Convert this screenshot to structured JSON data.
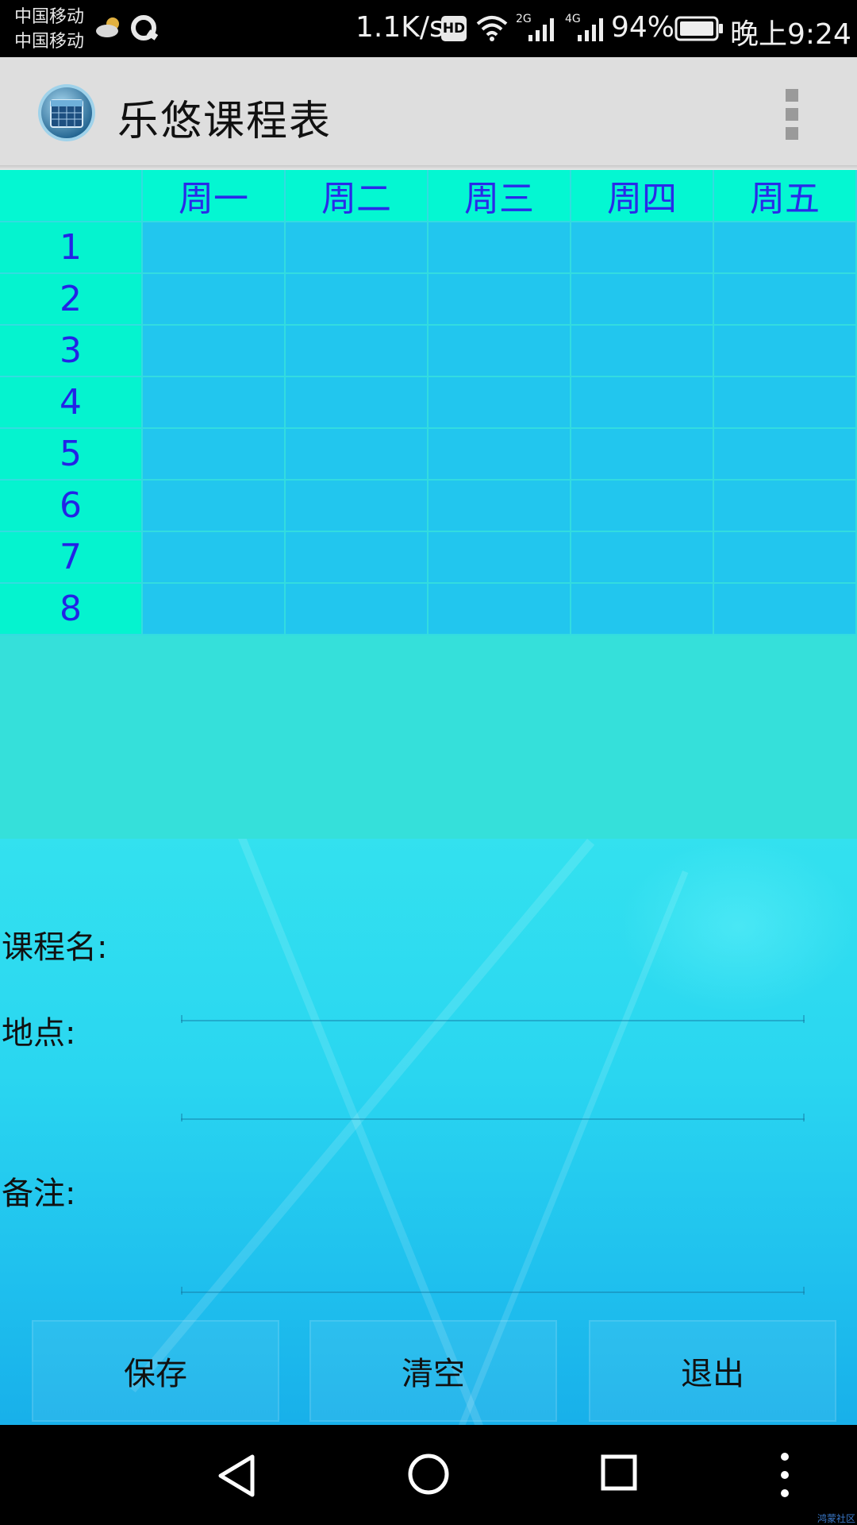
{
  "status_bar": {
    "carrier_1": "中国移动",
    "carrier_2": "中国移动",
    "net_speed": "1.1K/s",
    "hd_badge": "HD",
    "sig_2g": "2G",
    "sig_4g": "4G",
    "battery": "94%",
    "time": "晚上9:24",
    "icons": [
      "weather-cloudy-icon",
      "q-app-icon",
      "wifi-icon",
      "signal-icon",
      "battery-icon"
    ]
  },
  "app_bar": {
    "title": "乐悠课程表",
    "logo_icon": "calendar-icon",
    "menu_icon": "overflow-menu-icon"
  },
  "timetable": {
    "days": [
      "周一",
      "周二",
      "周三",
      "周四",
      "周五"
    ],
    "periods": [
      "1",
      "2",
      "3",
      "4",
      "5",
      "6",
      "7",
      "8"
    ]
  },
  "form": {
    "course_label": "课程名:",
    "course_value": "",
    "location_label": "地点:",
    "location_value": "",
    "note_label": "备注:",
    "note_value": ""
  },
  "buttons": {
    "save": "保存",
    "clear": "清空",
    "exit": "退出"
  },
  "nav_bar": {
    "icons": [
      "back-icon",
      "home-icon",
      "recents-icon",
      "more-icon"
    ],
    "watermark": "鸿蒙社区"
  },
  "colors": {
    "header_cell": "#04f7d2",
    "slot_cell": "#22c6ee",
    "day_text": "#2a2ae8",
    "app_bar": "#dedede"
  }
}
